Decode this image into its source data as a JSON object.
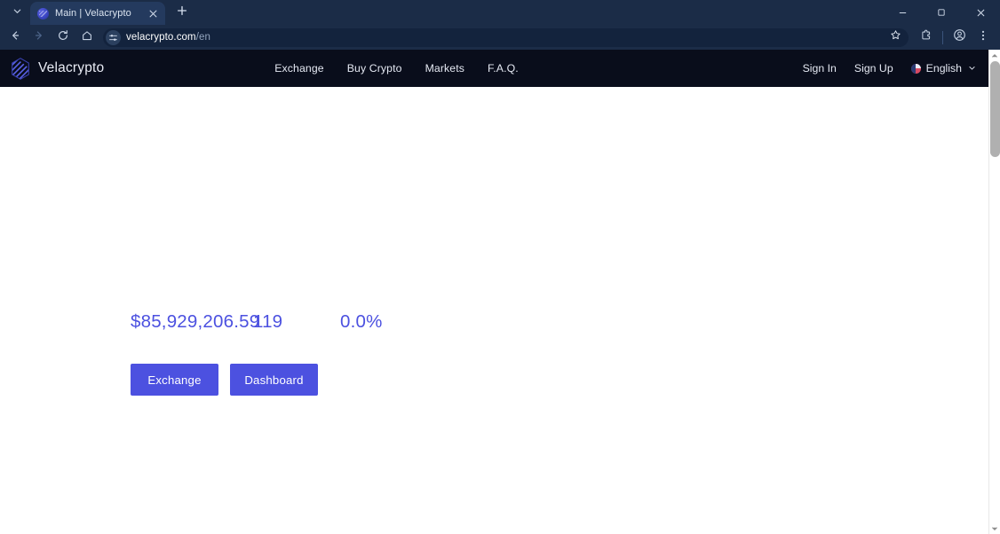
{
  "browser": {
    "tab": {
      "title": "Main | Velacrypto",
      "favicon_icon": "velacrypto-favicon",
      "close_icon": "close-icon",
      "list_icon": "chevron-down-icon",
      "new_tab_icon": "plus-icon"
    },
    "window_controls": {
      "minimize_icon": "minimize-icon",
      "maximize_icon": "maximize-icon",
      "close_icon": "close-icon"
    },
    "toolbar": {
      "back_icon": "arrow-left-icon",
      "forward_icon": "arrow-right-icon",
      "reload_icon": "reload-icon",
      "home_icon": "home-icon",
      "site_info_icon": "site-settings-icon",
      "url_host": "velacrypto.com",
      "url_path": "/en",
      "bookmark_icon": "star-icon",
      "extensions_icon": "puzzle-piece-icon",
      "profile_icon": "profile-avatar-icon",
      "menu_icon": "three-dot-menu-icon"
    },
    "scrollbar": {
      "up_icon": "scroll-up-arrow-icon",
      "down_icon": "scroll-down-arrow-icon"
    }
  },
  "site": {
    "brand": {
      "name": "Velacrypto",
      "logo_icon": "velacrypto-hex-logo"
    },
    "nav": [
      {
        "label": "Exchange"
      },
      {
        "label": "Buy Crypto"
      },
      {
        "label": "Markets"
      },
      {
        "label": "F.A.Q."
      }
    ],
    "account": {
      "sign_in": "Sign In",
      "sign_up": "Sign Up"
    },
    "language": {
      "label": "English",
      "flag_icon": "language-flag-icon",
      "chevron_icon": "chevron-down-icon"
    }
  },
  "hero": {
    "stats": [
      {
        "value": "$85,929,206.59"
      },
      {
        "value": "119"
      },
      {
        "value": "0.0%"
      }
    ],
    "buttons": {
      "exchange": "Exchange",
      "dashboard": "Dashboard"
    }
  },
  "colors": {
    "browser_chrome": "#1b2c47",
    "tab_active": "#243a5e",
    "omnibox": "#13233d",
    "site_header": "#090d1b",
    "accent": "#4c51e0",
    "page_background": "#ffffff"
  }
}
